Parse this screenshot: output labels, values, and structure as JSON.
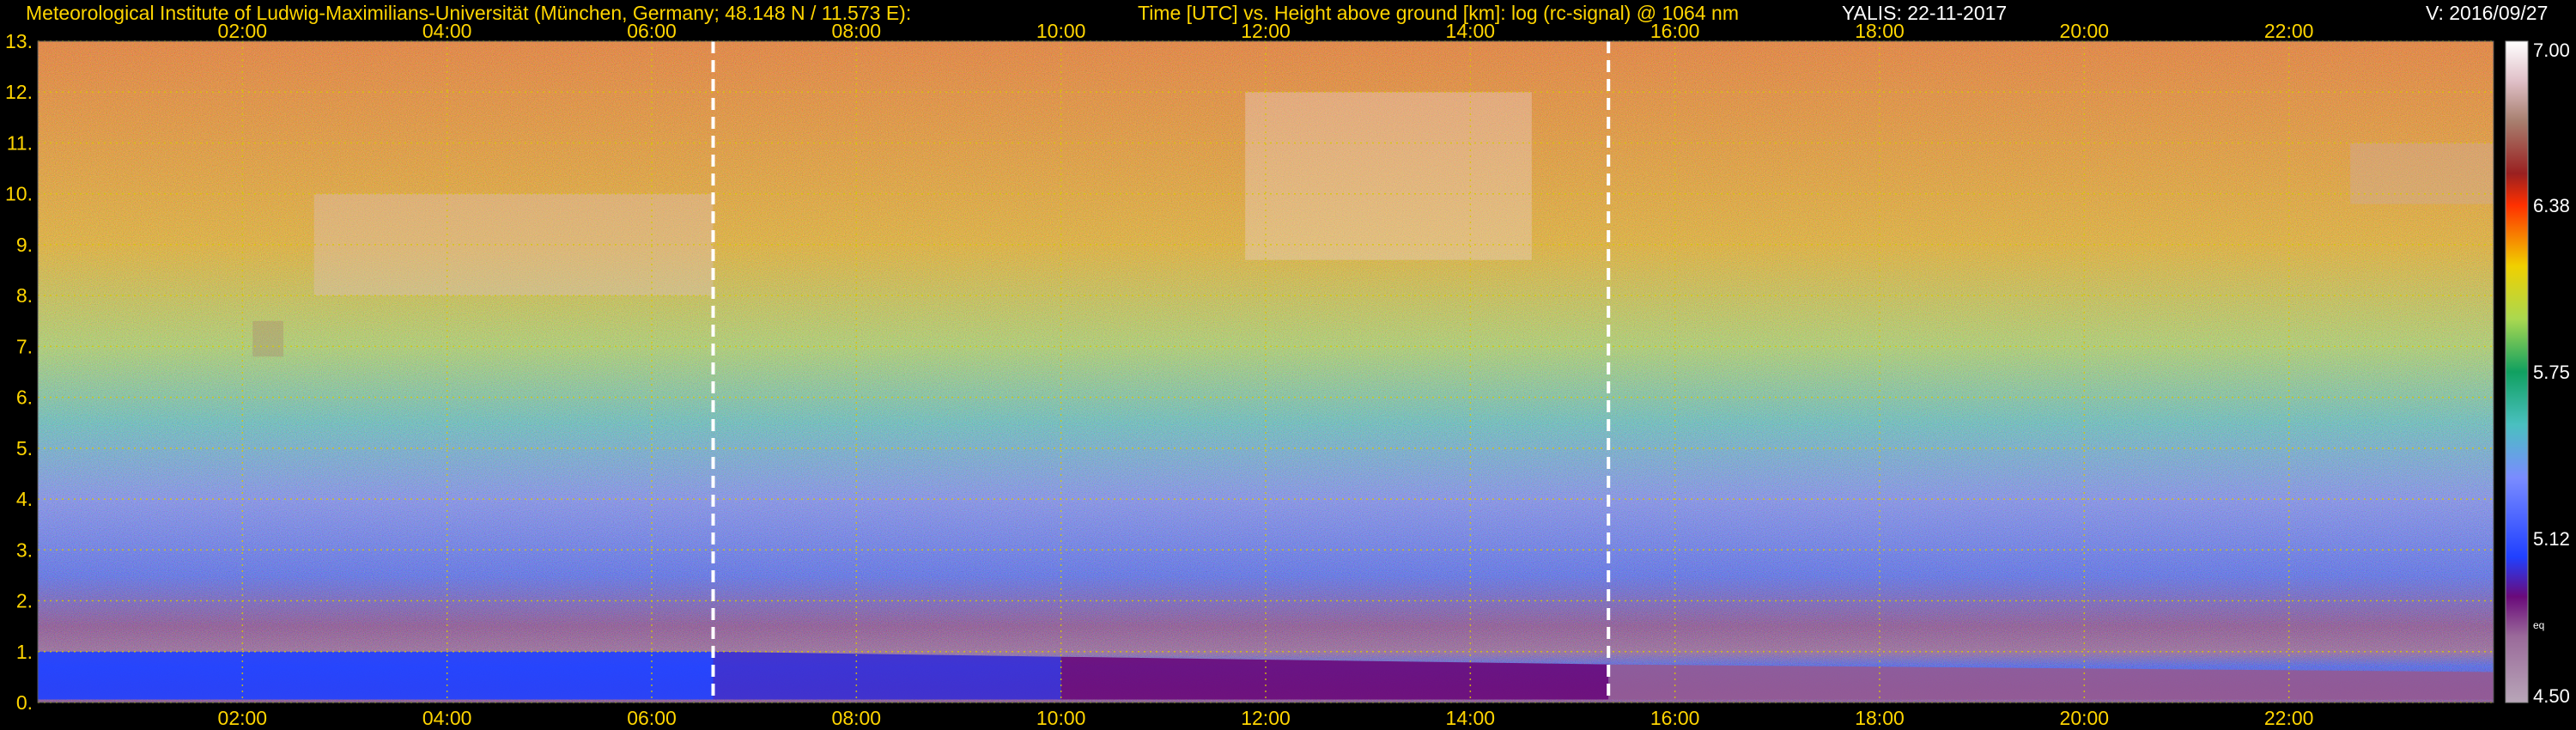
{
  "header": {
    "institute": "Meteorological Institute of Ludwig-Maximilians-Universität (München, Germany; 48.148 N / 11.573 E):",
    "plot_title": "Time [UTC] vs. Height above ground [km]: log (rc-signal) @ 1064 nm",
    "instrument": "YALIS: 22-11-2017",
    "version": "V: 2016/09/27"
  },
  "colors": {
    "text_yellow": "#ffd500",
    "text_white": "#ffffff",
    "grid": "#d8c800",
    "marker": "#ffffff",
    "background": "#000000"
  },
  "chart_data": {
    "type": "heatmap",
    "title": "Time [UTC] vs. Height above ground [km]: log (rc-signal) @ 1064 nm",
    "xlabel": "Time [UTC]",
    "ylabel": "Height above ground [km]",
    "xlim": [
      0,
      24
    ],
    "ylim": [
      0,
      13
    ],
    "x_ticks": [
      2,
      4,
      6,
      8,
      10,
      12,
      14,
      16,
      18,
      20,
      22
    ],
    "x_tick_labels": [
      "02:00",
      "04:00",
      "06:00",
      "08:00",
      "10:00",
      "12:00",
      "14:00",
      "16:00",
      "18:00",
      "20:00",
      "22:00"
    ],
    "y_ticks": [
      0,
      1,
      2,
      3,
      4,
      5,
      6,
      7,
      8,
      9,
      10,
      11,
      12,
      13
    ],
    "y_tick_labels": [
      "0.",
      "1.",
      "2.",
      "3.",
      "4.",
      "5.",
      "6.",
      "7.",
      "8.",
      "9.",
      "10.",
      "11.",
      "12.",
      "13."
    ],
    "grid": true,
    "markers_time_utc": [
      6.6,
      15.35
    ],
    "colorbar": {
      "min": 4.5,
      "max": 7.0,
      "tick_values": [
        7.0,
        6.38,
        5.75,
        5.12,
        4.5
      ],
      "tick_labels": [
        "7.00",
        "6.38",
        "5.75",
        "5.12",
        "4.50"
      ],
      "small_label": "eq",
      "stops": [
        {
          "value": 4.5,
          "color": "#b8a6b8"
        },
        {
          "value": 4.75,
          "color": "#9a6a9a"
        },
        {
          "value": 4.9,
          "color": "#6a0a7a"
        },
        {
          "value": 5.05,
          "color": "#2040ff"
        },
        {
          "value": 5.35,
          "color": "#7a8cff"
        },
        {
          "value": 5.55,
          "color": "#4ac0c0"
        },
        {
          "value": 5.75,
          "color": "#10a060"
        },
        {
          "value": 5.95,
          "color": "#aad850"
        },
        {
          "value": 6.15,
          "color": "#f0d000"
        },
        {
          "value": 6.38,
          "color": "#ff3000"
        },
        {
          "value": 6.5,
          "color": "#9a2020"
        },
        {
          "value": 6.7,
          "color": "#a88070"
        },
        {
          "value": 6.85,
          "color": "#e0c0c8"
        },
        {
          "value": 7.0,
          "color": "#ffffff"
        }
      ]
    },
    "signal_profile": [
      {
        "height_km": 0.0,
        "value": 4.85
      },
      {
        "height_km": 0.3,
        "value": 4.95
      },
      {
        "height_km": 0.7,
        "value": 5.05
      },
      {
        "height_km": 1.0,
        "value": 4.8
      },
      {
        "height_km": 1.5,
        "value": 4.85
      },
      {
        "height_km": 2.5,
        "value": 5.12
      },
      {
        "height_km": 4.0,
        "value": 5.3
      },
      {
        "height_km": 5.5,
        "value": 5.55
      },
      {
        "height_km": 7.0,
        "value": 5.95
      },
      {
        "height_km": 9.0,
        "value": 6.2
      },
      {
        "height_km": 13.0,
        "value": 6.3
      }
    ],
    "boundary_layer": [
      {
        "time_utc": 0.0,
        "top_km": 1.0,
        "value": 5.05
      },
      {
        "time_utc": 6.6,
        "top_km": 1.0,
        "value": 5.05
      },
      {
        "time_utc": 10.0,
        "top_km": 0.9,
        "value": 4.95
      },
      {
        "time_utc": 15.35,
        "top_km": 0.75,
        "value": 4.85
      },
      {
        "time_utc": 24.0,
        "top_km": 0.6,
        "value": 4.7
      }
    ],
    "cloud_features": [
      {
        "time_start": 2.7,
        "time_end": 6.6,
        "base_km": 8.0,
        "top_km": 10.0,
        "value": 6.85
      },
      {
        "time_start": 11.8,
        "time_end": 14.6,
        "base_km": 8.7,
        "top_km": 12.0,
        "value": 6.9
      },
      {
        "time_start": 22.6,
        "time_end": 24.0,
        "base_km": 9.8,
        "top_km": 11.0,
        "value": 6.8
      },
      {
        "time_start": 2.1,
        "time_end": 2.4,
        "base_km": 6.8,
        "top_km": 7.5,
        "value": 6.7
      }
    ]
  }
}
